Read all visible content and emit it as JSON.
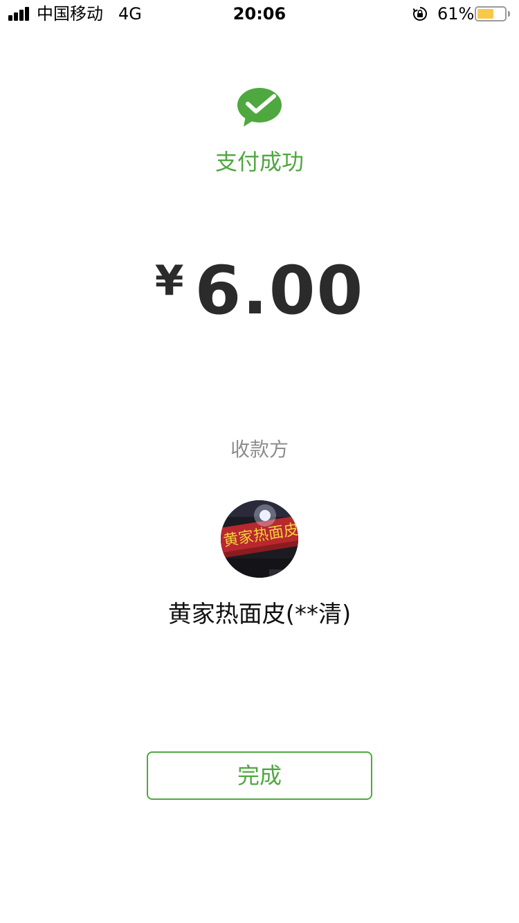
{
  "status_bar": {
    "carrier": "中国移动",
    "network": "4G",
    "time": "20:06",
    "battery_percent": "61%",
    "battery_level": 0.61,
    "icons": [
      "signal-icon",
      "orientation-lock-icon",
      "battery-icon"
    ]
  },
  "payment": {
    "icon": "wechat-pay-icon",
    "title": "支付成功",
    "currency_symbol": "¥",
    "amount": "6.00"
  },
  "payee": {
    "label": "收款方",
    "avatar": "avatar",
    "avatar_sign_text": "黄家热面皮",
    "name": "黄家热面皮(**清)"
  },
  "actions": {
    "done_label": "完成"
  },
  "colors": {
    "accent": "#4ea83f",
    "amount_text": "#2b2b2b",
    "secondary_text": "#8d8d8d",
    "battery_fill": "#f7c948"
  }
}
